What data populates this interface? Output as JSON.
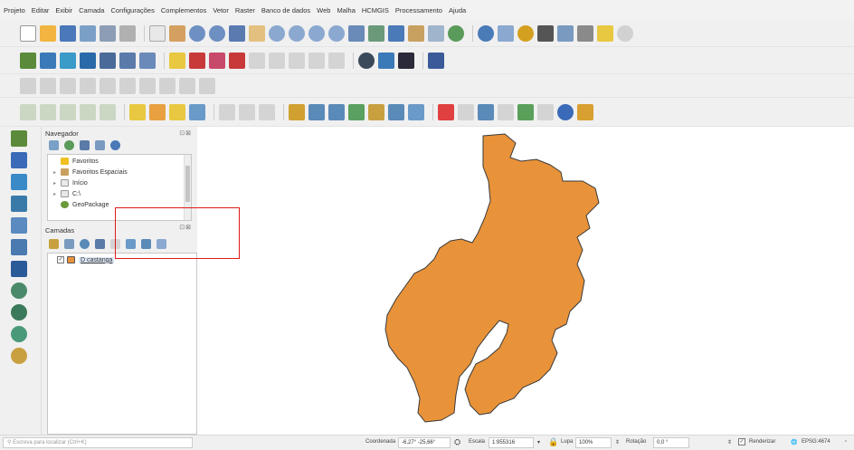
{
  "menu": [
    "Projeto",
    "Editar",
    "Exibir",
    "Camada",
    "Configurações",
    "Complementos",
    "Vetor",
    "Raster",
    "Banco de dados",
    "Web",
    "Malha",
    "HCMGIS",
    "Processamento",
    "Ajuda"
  ],
  "colors": {
    "polygon_fill": "#e8923a",
    "polygon_stroke": "#3a3a3a",
    "highlight_box": "#e01a1a"
  },
  "navigator": {
    "title": "Navegador",
    "controls": "⊡⊠",
    "items": [
      "Favoritos",
      "Favoritos Espaciais",
      "Início",
      "C:\\",
      "GeoPackage"
    ]
  },
  "layers": {
    "title": "Camadas",
    "controls": "⊡⊠",
    "items": [
      {
        "name": "D castanga",
        "checked": true
      }
    ]
  },
  "status": {
    "search_placeholder": "Escreva para localizar (Ctrl+K)",
    "coord_label": "Coordenada",
    "coord_value": "-6,27° -25,66°",
    "scale_label": "Escala",
    "scale_value": "1:955316",
    "magnifier_label": "Lupa",
    "magnifier_value": "100%",
    "rotation_label": "Rotação",
    "rotation_value": "0,0 °",
    "render_label": "Renderizar",
    "crs": "EPSG:4674"
  }
}
